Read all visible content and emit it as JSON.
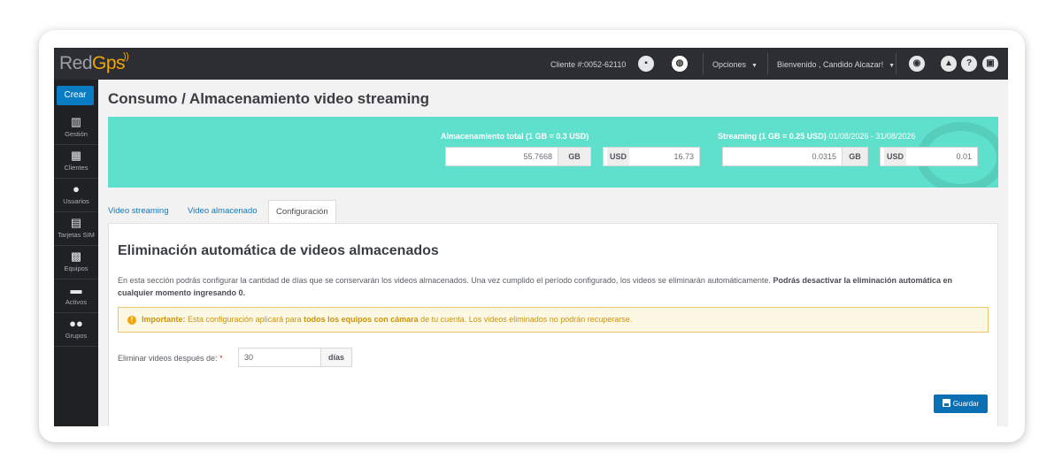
{
  "topbar": {
    "logo_red": "Red",
    "logo_gps": "Gps",
    "client": "Cliente #:0052-62110",
    "options": "Opciones",
    "welcome": "Bienvenido , Candido Alcazar!"
  },
  "sidebar": {
    "create": "Crear",
    "items": [
      {
        "label": "Gestión",
        "icon": "building-gear-icon"
      },
      {
        "label": "Clientes",
        "icon": "building-icon"
      },
      {
        "label": "Usuarios",
        "icon": "user-icon"
      },
      {
        "label": "Tarjetas SIM",
        "icon": "sim-card-icon"
      },
      {
        "label": "Equipos",
        "icon": "device-icon"
      },
      {
        "label": "Activos",
        "icon": "car-icon"
      },
      {
        "label": "Grupos",
        "icon": "group-icon"
      }
    ]
  },
  "page": {
    "title": "Consumo / Almacenamiento video streaming"
  },
  "banner": {
    "storage_label": "Almacenamiento total (1 GB = 0.3 USD)",
    "storage_gb": "55.7668",
    "storage_usd": "16.73",
    "streaming_label": "Streaming (1 GB = 0.25 USD)",
    "streaming_range": "01/08/2026 - 31/08/2026",
    "streaming_gb": "0.0315",
    "streaming_usd": "0.01",
    "gb_unit": "GB",
    "usd_unit": "USD",
    "color": "#5fe0cc"
  },
  "tabs": [
    {
      "label": "Video streaming"
    },
    {
      "label": "Video almacenado"
    },
    {
      "label": "Configuración"
    }
  ],
  "config": {
    "title": "Eliminación automática de videos almacenados",
    "desc_normal": "En esta sección podrás configurar la cantidad de días que se conservarán los videos almacenados. Una vez cumplido el período configurado, los videos se eliminarán automáticamente.",
    "desc_bold": "Podrás desactivar la eliminación automática en cualquier momento ingresando 0.",
    "alert_strong": "Importante:",
    "alert_text1": "Esta configuración aplicará para",
    "alert_bold": "todos los equipos con cámara",
    "alert_text2": "de tu cuenta. Los videos eliminados no podrán recuperarse.",
    "field_label": "Eliminar videos después de:",
    "field_required": "*",
    "field_value": "30",
    "field_unit": "días",
    "save": "Guardar"
  }
}
